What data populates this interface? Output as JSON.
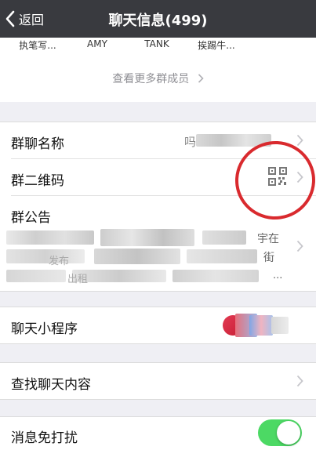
{
  "navbar": {
    "back_label": "返回",
    "title": "聊天信息(499)"
  },
  "members": {
    "names": [
      "执笔写...",
      "AMY",
      "TANK",
      "挨踢牛..."
    ],
    "see_more": "查看更多群成员"
  },
  "group": {
    "name_label": "群聊名称",
    "name_value_partial": "吗",
    "qrcode_label": "群二维码",
    "notice_label": "群公告",
    "notice_fragments": [
      "发布",
      "宇在",
      "街",
      "...",
      "出租"
    ]
  },
  "mini_program": {
    "label": "聊天小程序"
  },
  "search": {
    "label": "查找聊天内容"
  },
  "mute": {
    "label": "消息免打扰",
    "enabled": true
  },
  "colors": {
    "navbar": "#393a3f",
    "toggle_on": "#4cd964",
    "highlight_circle": "#d92a2e"
  }
}
